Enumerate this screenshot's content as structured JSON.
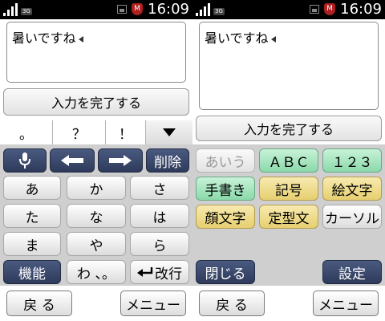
{
  "status": {
    "network": "3G",
    "time": "16:09"
  },
  "left": {
    "text_input": "暑いですね",
    "complete_button": "入力を完了する",
    "candidates": [
      "。",
      "？",
      "！"
    ],
    "keys": {
      "delete": "削除",
      "a": "あ",
      "ka": "か",
      "sa": "さ",
      "ta": "た",
      "na": "な",
      "ha": "は",
      "ma": "ま",
      "ya": "や",
      "ra": "ら",
      "function": "機能",
      "wa": "わ 、。",
      "newline": "改行"
    },
    "softkeys": {
      "back": "戻 る",
      "menu": "メニュー"
    }
  },
  "right": {
    "text_input": "暑いですね",
    "complete_button": "入力を完了する",
    "modes": {
      "hiragana": "あいう",
      "alpha": "ＡＢＣ",
      "number": "１２３"
    },
    "tools": {
      "handwriting": "手書き",
      "symbols": "記号",
      "emoji": "絵文字",
      "kaomoji": "顔文字",
      "templates": "定型文",
      "cursor": "カーソル"
    },
    "close": "閉じる",
    "settings": "設定",
    "softkeys": {
      "back": "戻 る",
      "menu": "メニュー"
    }
  },
  "colors": {
    "dark_key": "#34406a",
    "green_key": "#a8e6c0",
    "yellow_key": "#eedc8a",
    "keyboard_bg": "#cfcfcf"
  }
}
